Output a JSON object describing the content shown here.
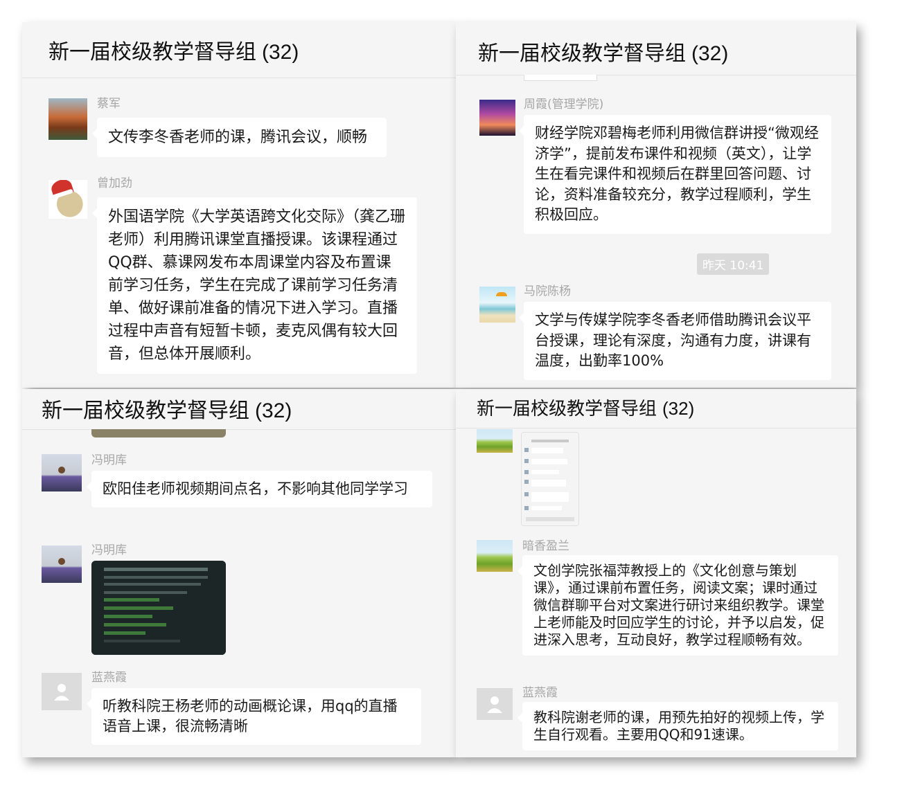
{
  "panels": [
    {
      "title": "新一届校级教学督导组",
      "count": "(32)",
      "messages": [
        {
          "sender": "蔡军",
          "text": "文传李冬香老师的课，腾讯会议，顺畅"
        },
        {
          "sender": "曾加劲",
          "text": "外国语学院《大学英语跨文化交际》（龚乙珊老师）利用腾讯课堂直播授课。该课程通过QQ群、慕课网发布本周课堂内容及布置课前学习任务，学生在完成了课前学习任务清单、做好课前准备的情况下进入学习。直播过程中声音有短暂卡顿，麦克风偶有较大回音，但总体开展顺利。"
        }
      ]
    },
    {
      "title": "新一届校级教学督导组",
      "count": "(32)",
      "messages": [
        {
          "sender": "周霞(管理学院)",
          "text": "财经学院邓碧梅老师利用微信群讲授“微观经济学”，提前发布课件和视频（英文），让学生在看完课件和视频后在群里回答问题、讨论，资料准备较充分，教学过程顺利，学生积极回应。"
        },
        {
          "sender": "马院陈杨",
          "text": "文学与传媒学院李冬香老师借助腾讯会议平台授课，理论有深度，沟通有力度，讲课有温度，出勤率100%"
        }
      ],
      "time": "昨天 10:41"
    },
    {
      "title": "新一届校级教学督导组",
      "count": "(32)",
      "messages": [
        {
          "sender": "冯明库",
          "text": "欧阳佳老师视频期间点名，不影响其他同学学习"
        },
        {
          "sender": "冯明库",
          "text": ""
        },
        {
          "sender": "蓝燕霞",
          "text": "听教科院王杨老师的动画概论课，用qq的直播语音上课，很流畅清晰"
        }
      ]
    },
    {
      "title": "新一届校级教学督导组",
      "count": "(32)",
      "messages": [
        {
          "sender": "暗香盈兰",
          "text": "文创学院张福萍教授上的《文化创意与策划课》，通过课前布置任务，阅读文案；课时通过微信群聊平台对文案进行研讨来组织教学。课堂上老师能及时回应学生的讨论，并予以启发，促进深入思考，互动良好，教学过程顺畅有效。"
        },
        {
          "sender": "蓝燕霞",
          "text": "教科院谢老师的课，用预先拍好的视频上传，学生自行观看。主要用QQ和91速课。"
        }
      ]
    }
  ]
}
